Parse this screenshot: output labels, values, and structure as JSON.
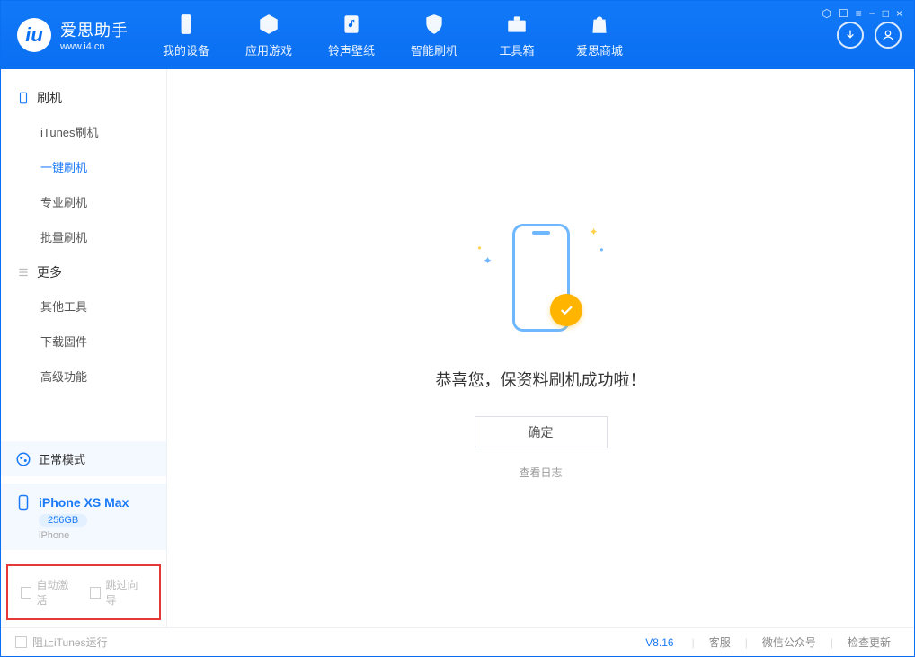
{
  "app": {
    "name": "爱思助手",
    "url": "www.i4.cn"
  },
  "tabs": {
    "device": "我的设备",
    "apps": "应用游戏",
    "ring": "铃声壁纸",
    "flash": "智能刷机",
    "toolbox": "工具箱",
    "store": "爱思商城"
  },
  "titlebar_icons": {
    "shirt": "shirt-icon",
    "lock": "lock-icon",
    "menu": "menu-icon",
    "min": "−",
    "max": "□",
    "close": "×"
  },
  "sidebar": {
    "group1": {
      "title": "刷机",
      "items": [
        "iTunes刷机",
        "一键刷机",
        "专业刷机",
        "批量刷机"
      ],
      "active_index": 1
    },
    "group2": {
      "title": "更多",
      "items": [
        "其他工具",
        "下载固件",
        "高级功能"
      ]
    },
    "mode": "正常模式",
    "device": {
      "name": "iPhone XS Max",
      "capacity": "256GB",
      "type": "iPhone"
    },
    "options": {
      "auto_activate": "自动激活",
      "skip_guide": "跳过向导"
    }
  },
  "main": {
    "message": "恭喜您，保资料刷机成功啦！",
    "ok": "确定",
    "view_log": "查看日志"
  },
  "statusbar": {
    "block_itunes": "阻止iTunes运行",
    "version": "V8.16",
    "links": [
      "客服",
      "微信公众号",
      "检查更新"
    ]
  }
}
